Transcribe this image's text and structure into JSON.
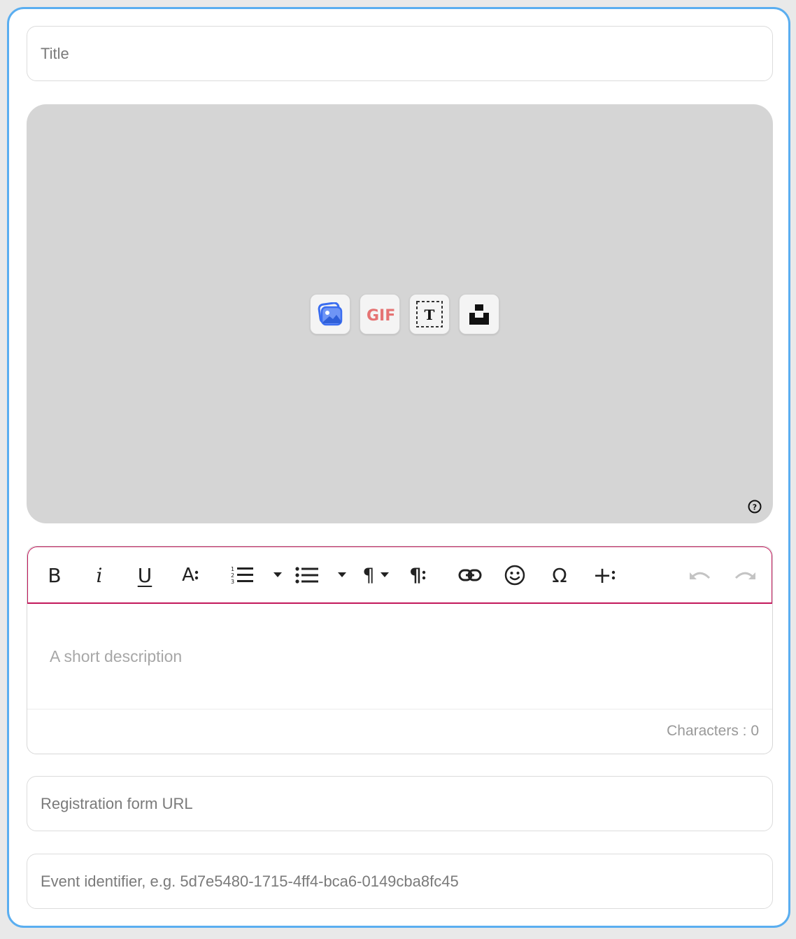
{
  "form": {
    "title_placeholder": "Title",
    "registration_placeholder": "Registration form URL",
    "event_placeholder": "Event identifier, e.g. 5d7e5480-1715-4ff4-bca6-0149cba8fc45"
  },
  "media": {
    "tools": [
      "image-upload-icon",
      "gif-icon",
      "text-frame-icon",
      "unsplash-icon"
    ],
    "gif_label": "GIF",
    "text_label": "T",
    "help_label": "?"
  },
  "editor": {
    "placeholder": "A short description",
    "char_count": "Characters : 0",
    "toolbar": {
      "bold": "B",
      "italic": "i",
      "underline": "U",
      "font_size": "A",
      "paragraph": "¶",
      "paragraph_more": "¶",
      "special_char": "Ω",
      "insert_more": "+"
    }
  },
  "colors": {
    "accent_border": "#5aaef0",
    "editor_focus": "#c2185b",
    "image_icon": "#3a6df0",
    "gif_icon": "#e57373"
  }
}
